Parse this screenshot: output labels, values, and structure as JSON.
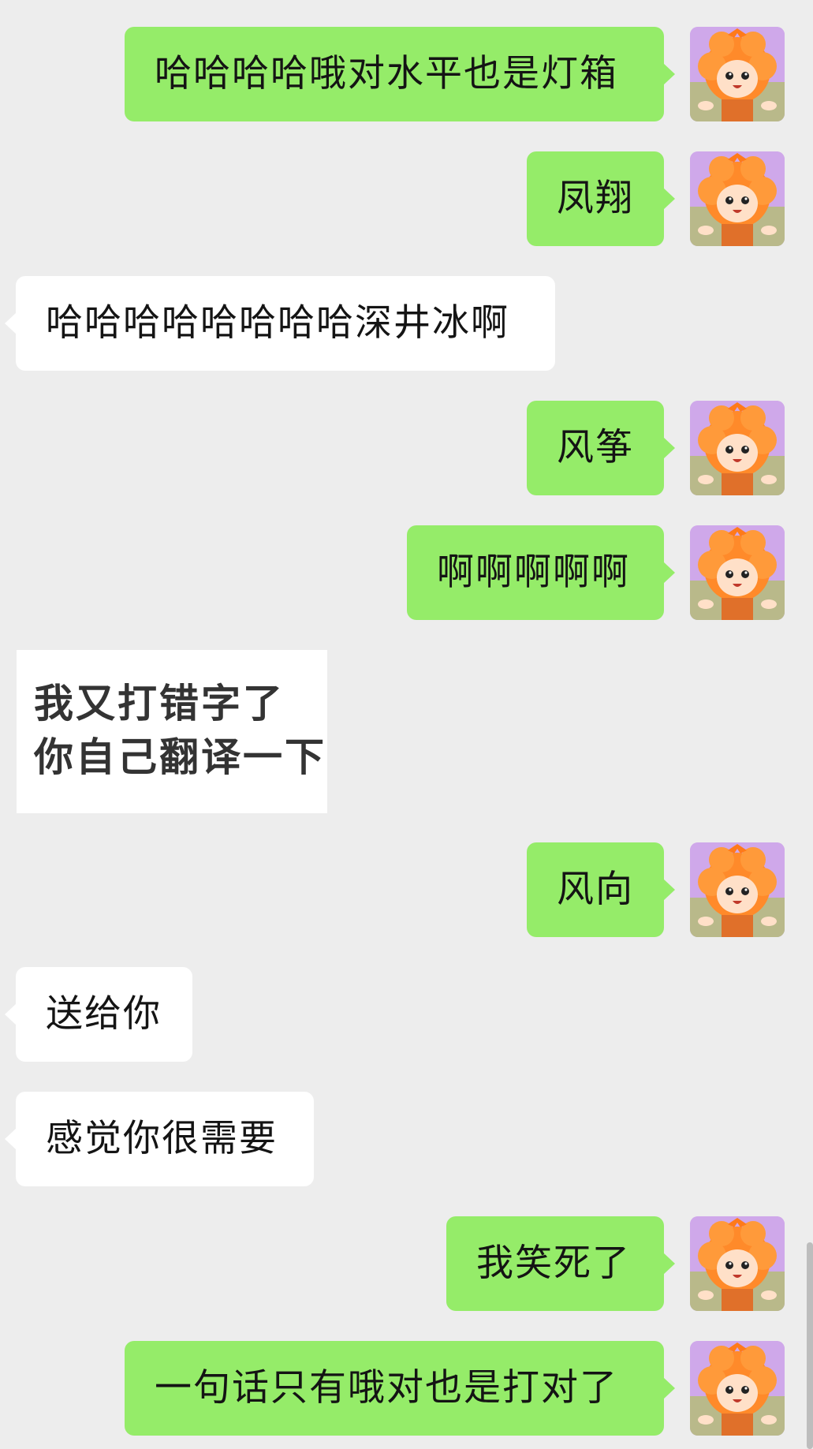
{
  "chat": {
    "messages": [
      {
        "side": "sent",
        "text": "哈哈哈哈哦对水平也是灯箱"
      },
      {
        "side": "sent",
        "text": "凤翔"
      },
      {
        "side": "recv",
        "text": "哈哈哈哈哈哈哈哈深井冰啊"
      },
      {
        "side": "sent",
        "text": "风筝"
      },
      {
        "side": "sent",
        "text": "啊啊啊啊啊"
      },
      {
        "side": "recv-sticker",
        "lines": [
          "我又打错字了",
          "你自己翻译一下"
        ]
      },
      {
        "side": "sent",
        "text": "风向"
      },
      {
        "side": "recv",
        "text": "送给你"
      },
      {
        "side": "recv",
        "text": "感觉你很需要"
      },
      {
        "side": "sent",
        "text": "我笑死了"
      },
      {
        "side": "sent",
        "text": "一句话只有哦对也是打对了"
      }
    ]
  },
  "avatar": {
    "icon": "cartoon-girl-avatar-icon"
  },
  "colors": {
    "background": "#ededed",
    "sent_bubble": "#95ec69",
    "received_bubble": "#ffffff"
  }
}
